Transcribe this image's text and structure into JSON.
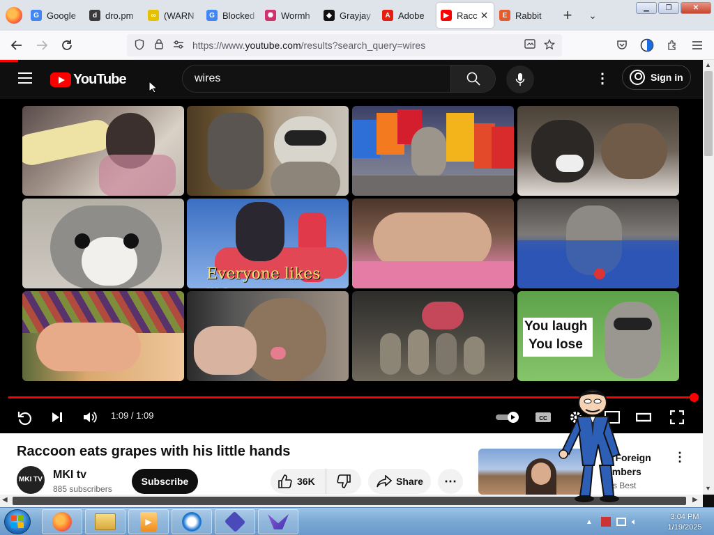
{
  "browser": {
    "tabs": [
      {
        "label": "Google",
        "favicon": "G",
        "color": "#4285f4"
      },
      {
        "label": "dro.pm",
        "favicon": "d",
        "color": "#3a3a3a"
      },
      {
        "label": "(WARN",
        "favicon": "∞",
        "color": "#e5c100"
      },
      {
        "label": "Blocked",
        "favicon": "G",
        "color": "#4285f4"
      },
      {
        "label": "Wormh",
        "favicon": "✺",
        "color": "#d0326e"
      },
      {
        "label": "Grayjay",
        "favicon": "◆",
        "color": "#111"
      },
      {
        "label": "Adobe",
        "favicon": "A",
        "color": "#e61e10"
      },
      {
        "label": "Racc",
        "favicon": "▶",
        "color": "#ff0000",
        "active": true
      },
      {
        "label": "Rabbit",
        "favicon": "E",
        "color": "#e65a2c"
      }
    ],
    "url": {
      "prefix": "https://www.",
      "host": "youtube.com",
      "path": "/results?search_query=wires"
    }
  },
  "youtube": {
    "logo_text": "YouTube",
    "search_value": "wires",
    "signin_label": "Sign in"
  },
  "player": {
    "time": "1:09 / 1:09",
    "progress_fraction": 1.0,
    "thumbnail_captions": {
      "everyone": "Everyone likes me.",
      "laugh1": "You laugh",
      "laugh2": "You lose"
    }
  },
  "video": {
    "title": "Raccoon eats grapes with his little hands",
    "channel_name": "MKI tv",
    "channel_avatar_text": "MKI TV",
    "subscribers": "885 subscribers",
    "subscribe_label": "Subscribe",
    "likes": "36K",
    "share_label": "Share"
  },
  "recommended": {
    "title_line1": "g Foreign",
    "title_line2": "embers",
    "channel": "e's Best"
  },
  "taskbar": {
    "time": "3:04 PM",
    "date": "1/19/2025"
  }
}
